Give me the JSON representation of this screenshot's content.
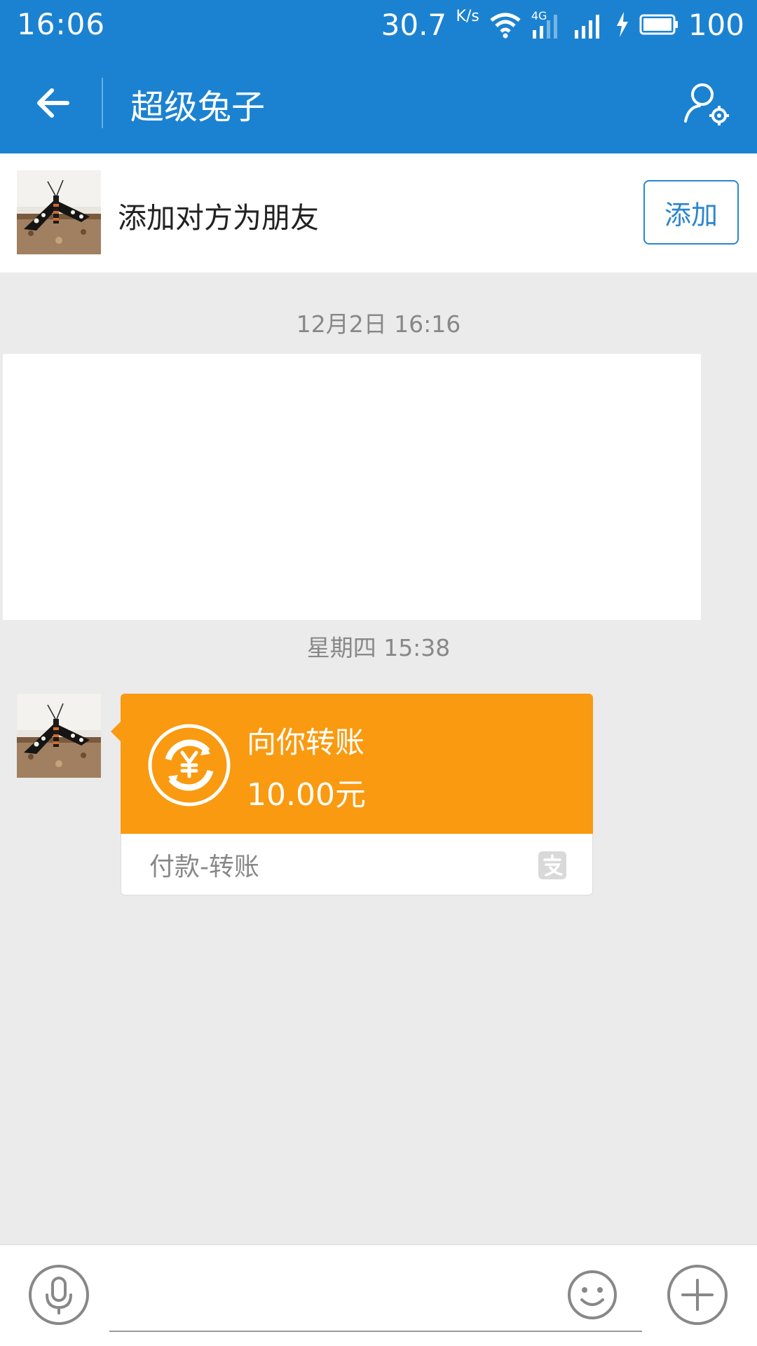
{
  "status_bar": {
    "time": "16:06",
    "net_speed": "30.7",
    "net_speed_unit": "K/s",
    "network_label": "4G",
    "battery": "100"
  },
  "nav": {
    "title": "超级兔子",
    "back_icon": "back-arrow-icon",
    "settings_icon": "user-settings-icon"
  },
  "add_friend": {
    "text": "添加对方为朋友",
    "button_label": "添加"
  },
  "messages": {
    "timestamp1": "12月2日 16:16",
    "timestamp2": "星期四 15:38",
    "transfer": {
      "title": "向你转账",
      "amount": "10.00元",
      "footer": "付款-转账"
    }
  },
  "input_bar": {
    "placeholder": ""
  },
  "colors": {
    "primary": "#1b82d1",
    "transfer_orange": "#f99a10",
    "background": "#ebebeb"
  }
}
